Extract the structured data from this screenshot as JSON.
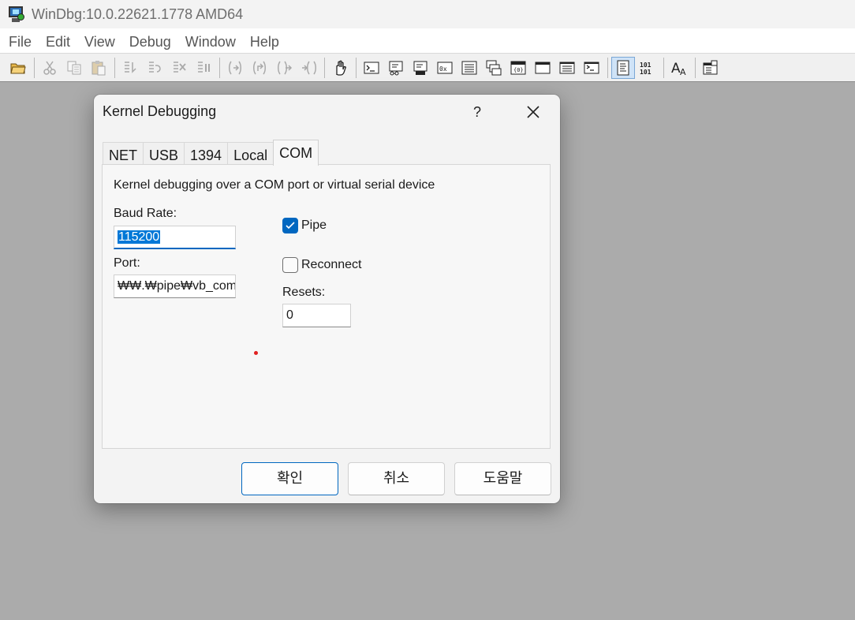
{
  "window": {
    "title": "WinDbg:10.0.22621.1778 AMD64",
    "icon": "windbg-app-icon"
  },
  "menu": {
    "items": [
      "File",
      "Edit",
      "View",
      "Debug",
      "Window",
      "Help"
    ]
  },
  "toolbar": {
    "buttons": [
      {
        "icon": "open-folder-icon",
        "enabled": true
      },
      {
        "icon": "cut-icon",
        "enabled": false
      },
      {
        "icon": "copy-icon",
        "enabled": false
      },
      {
        "icon": "paste-icon",
        "enabled": false
      },
      {
        "icon": "go-icon",
        "enabled": false
      },
      {
        "icon": "restart-icon",
        "enabled": false
      },
      {
        "icon": "stop-debugging-icon",
        "enabled": false
      },
      {
        "icon": "break-icon",
        "enabled": false
      },
      {
        "icon": "step-into-icon",
        "enabled": false
      },
      {
        "icon": "step-over-icon",
        "enabled": false
      },
      {
        "icon": "step-out-icon",
        "enabled": false
      },
      {
        "icon": "run-to-cursor-icon",
        "enabled": false
      },
      {
        "icon": "source-mode-hand-icon",
        "enabled": true
      },
      {
        "icon": "command-window-icon",
        "enabled": true
      },
      {
        "icon": "watch-window-icon",
        "enabled": true
      },
      {
        "icon": "locals-window-icon",
        "enabled": true
      },
      {
        "icon": "registers-window-icon",
        "enabled": true
      },
      {
        "icon": "memory-window-icon",
        "enabled": true
      },
      {
        "icon": "call-stack-icon",
        "enabled": true
      },
      {
        "icon": "disassembly-icon",
        "enabled": true
      },
      {
        "icon": "scratch-pad-icon",
        "enabled": true
      },
      {
        "icon": "processes-threads-icon",
        "enabled": true
      },
      {
        "icon": "command-browser-icon",
        "enabled": true
      },
      {
        "icon": "source-mode-icon",
        "enabled": true,
        "pressed": true
      },
      {
        "icon": "binary-mode-icon",
        "enabled": true
      },
      {
        "icon": "font-icon",
        "enabled": true
      },
      {
        "icon": "options-icon",
        "enabled": true
      }
    ]
  },
  "dialog": {
    "title": "Kernel Debugging",
    "help_glyph": "?",
    "tabs": [
      "NET",
      "USB",
      "1394",
      "Local",
      "COM"
    ],
    "active_tab": "COM",
    "description": "Kernel debugging over a COM port or virtual serial device",
    "baud_rate": {
      "label": "Baud Rate:",
      "value": "115200"
    },
    "port": {
      "label": "Port:",
      "value": "₩₩.₩pipe₩vb_com"
    },
    "pipe": {
      "label": "Pipe",
      "checked": true
    },
    "reconnect": {
      "label": "Reconnect",
      "checked": false
    },
    "resets": {
      "label": "Resets:",
      "value": "0"
    },
    "buttons": {
      "ok": "확인",
      "cancel": "취소",
      "help": "도움말"
    }
  },
  "colors": {
    "accent": "#0067c0",
    "workspace": "#ababab",
    "dialog_bg": "#f3f3f3"
  }
}
